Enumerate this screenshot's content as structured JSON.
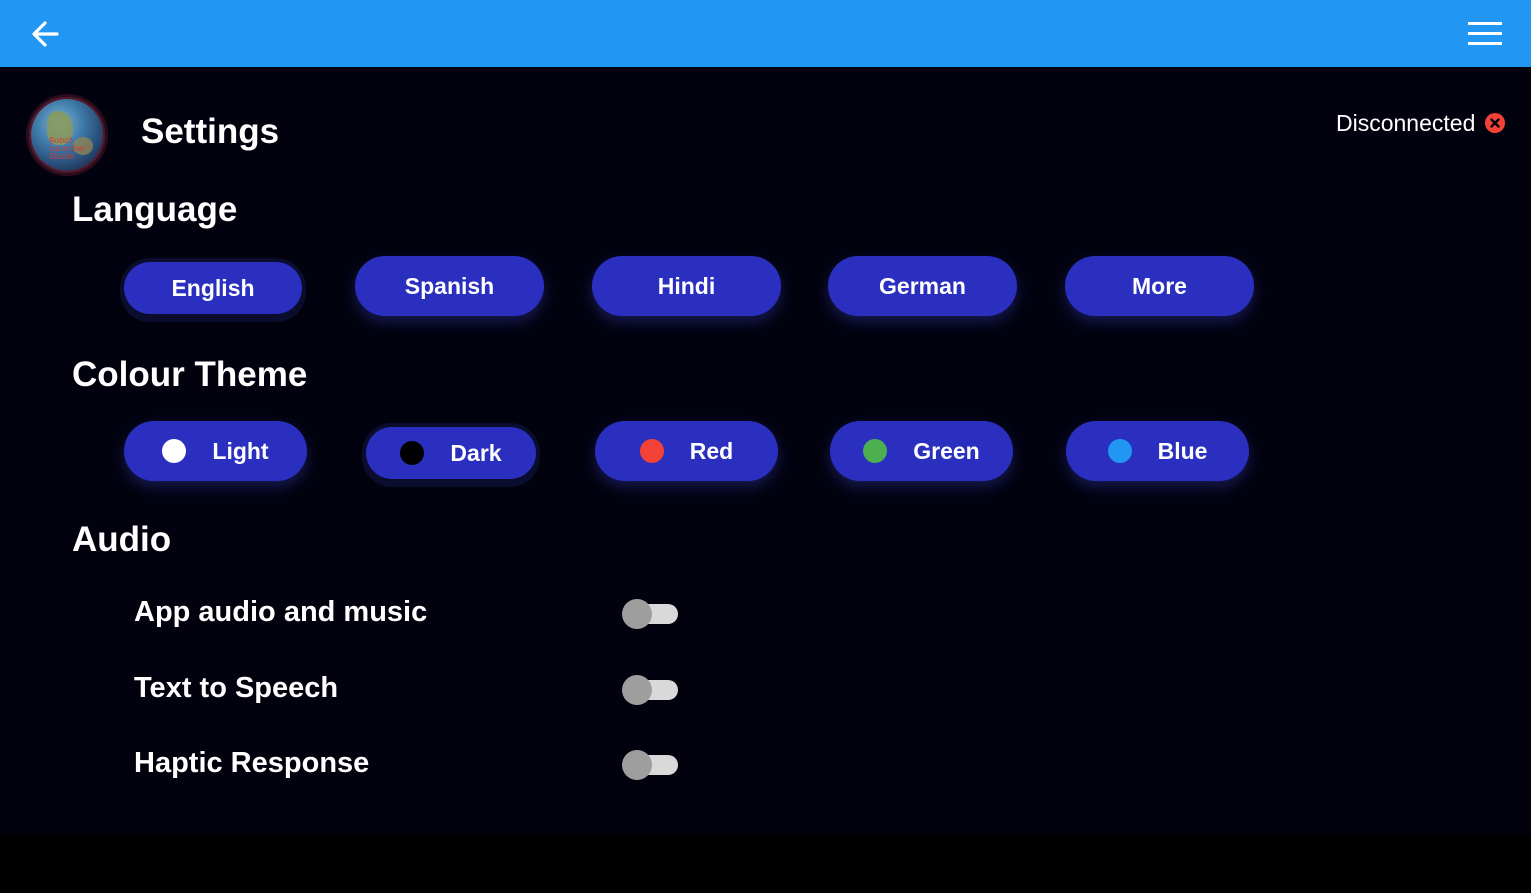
{
  "header": {
    "back_icon": "arrow-left-icon",
    "menu_icon": "hamburger-menu-icon",
    "bar_color": "#2196f3"
  },
  "page": {
    "title": "Settings",
    "logo_text": "Robot Launcher Studio",
    "status_text": "Disconnected",
    "status_icon": "close-circle-icon",
    "status_color": "#f44336"
  },
  "language": {
    "title": "Language",
    "options": [
      {
        "label": "English",
        "selected": true
      },
      {
        "label": "Spanish",
        "selected": false
      },
      {
        "label": "Hindi",
        "selected": false
      },
      {
        "label": "German",
        "selected": false
      },
      {
        "label": "More",
        "selected": false
      }
    ]
  },
  "theme": {
    "title": "Colour Theme",
    "options": [
      {
        "label": "Light",
        "color": "#ffffff",
        "selected": false
      },
      {
        "label": "Dark",
        "color": "#000000",
        "selected": true
      },
      {
        "label": "Red",
        "color": "#f44336",
        "selected": false
      },
      {
        "label": "Green",
        "color": "#4caf50",
        "selected": false
      },
      {
        "label": "Blue",
        "color": "#2196f3",
        "selected": false
      }
    ]
  },
  "audio": {
    "title": "Audio",
    "settings": [
      {
        "label": "App audio and music",
        "enabled": false
      },
      {
        "label": "Text to Speech",
        "enabled": false
      },
      {
        "label": "Haptic Response",
        "enabled": false
      }
    ]
  },
  "colors": {
    "pill": "#2a2fbf",
    "background": "#02020f"
  }
}
